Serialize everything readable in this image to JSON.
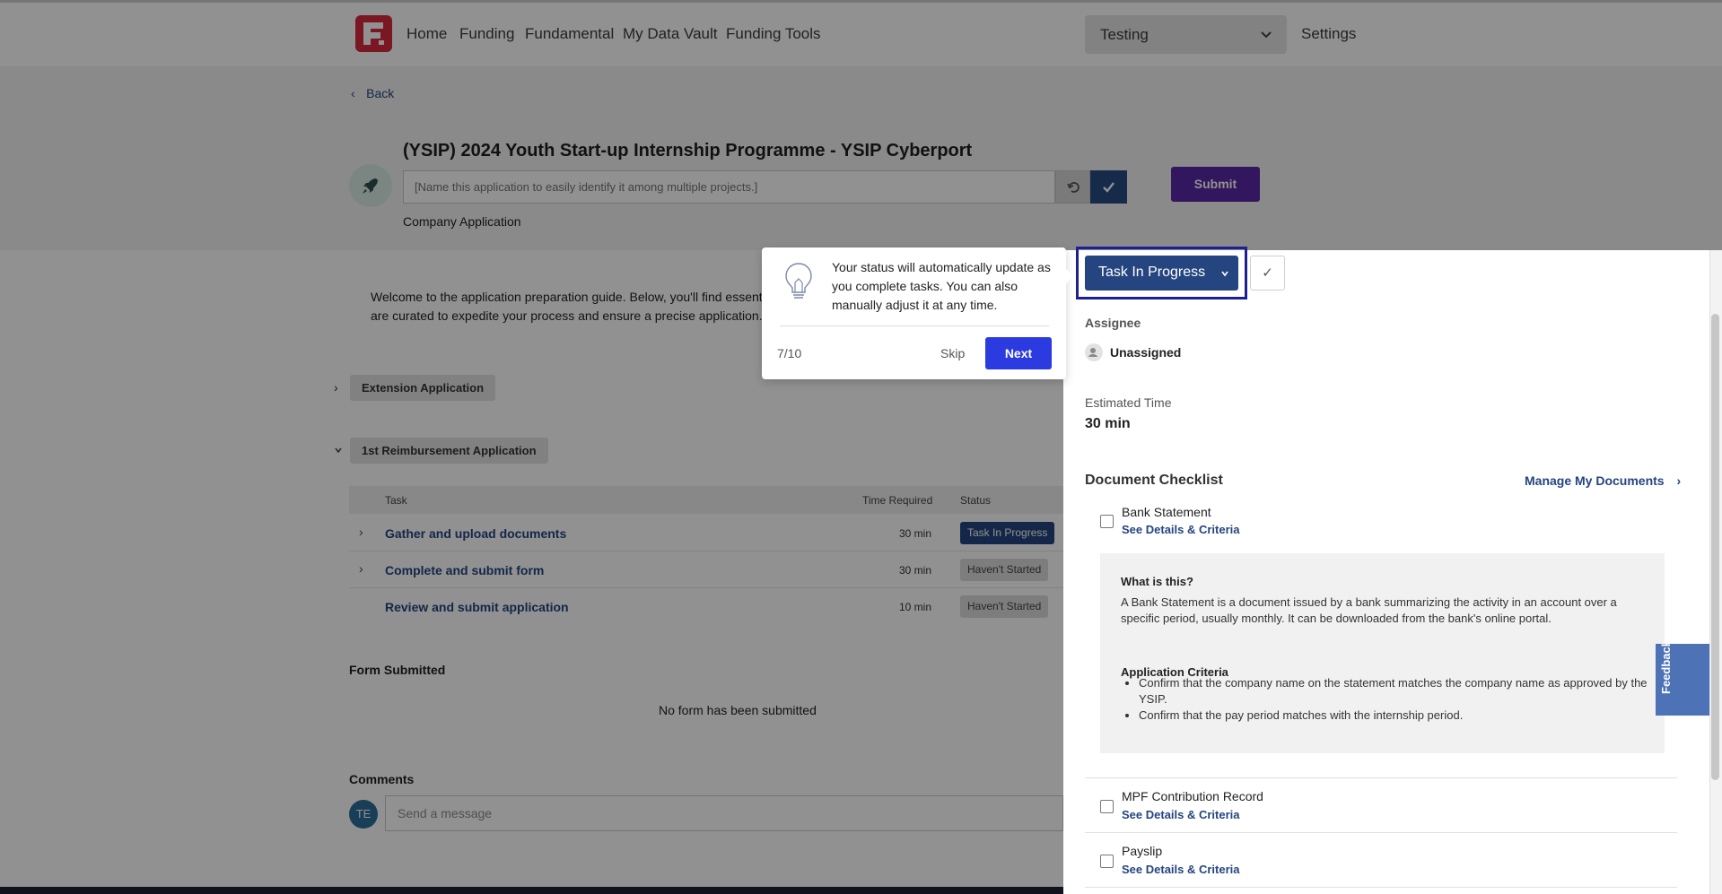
{
  "nav": {
    "logo_letter": "F.",
    "links": [
      "Home",
      "Funding",
      "Fundamental",
      "My Data Vault",
      "Funding Tools"
    ],
    "workspace": "Testing",
    "settings": "Settings"
  },
  "page": {
    "back": "Back",
    "title": "(YSIP) 2024 Youth Start-up Internship Programme - YSIP Cyberport",
    "name_placeholder": "[Name this application to easily identify it among multiple projects.]",
    "submit": "Submit",
    "company_app": "Company Application",
    "welcome": "Welcome to the application preparation guide. Below, you'll find essent... are curated to expedite your process and ensure a precise application.",
    "welcome_line1": "Welcome to the application preparation guide. Below, you'll find essent",
    "welcome_line2": "are curated to expedite your process and ensure a precise application."
  },
  "sections": [
    {
      "label": "Extension Application",
      "expanded": false
    },
    {
      "label": "1st Reimbursement Application",
      "expanded": true
    }
  ],
  "table": {
    "headers": {
      "task": "Task",
      "time": "Time Required",
      "status": "Status"
    },
    "rows": [
      {
        "task": "Gather and upload documents",
        "time": "30 min",
        "status": "Task In Progress"
      },
      {
        "task": "Complete and submit form",
        "time": "30 min",
        "status": "Haven't Started"
      },
      {
        "task": "Review and submit application",
        "time": "10 min",
        "status": "Haven't Started"
      }
    ]
  },
  "form_submitted": {
    "label": "Form Submitted",
    "empty": "No form has been submitted"
  },
  "comments": {
    "label": "Comments",
    "avatar": "TE",
    "placeholder": "Send a message"
  },
  "drawer": {
    "status": "Task In Progress",
    "assignee_label": "Assignee",
    "assignee": "Unassigned",
    "est_label": "Estimated Time",
    "est_value": "30 min",
    "checklist_label": "Document Checklist",
    "manage_link": "Manage My Documents",
    "docs": [
      {
        "name": "Bank Statement",
        "link": "See Details & Criteria"
      },
      {
        "name": "MPF Contribution Record",
        "link": "See Details & Criteria"
      },
      {
        "name": "Payslip",
        "link": "See Details & Criteria"
      }
    ],
    "detail": {
      "what_title": "What is this?",
      "what_text": "A Bank Statement is a document issued by a bank summarizing the activity in an account over a specific period, usually monthly. It can be downloaded from the bank's online portal.",
      "criteria_title": "Application Criteria",
      "criteria": [
        "Confirm that the company name on the statement matches the company name as approved by the YSIP.",
        "Confirm that the pay period matches with the internship period."
      ]
    },
    "feedback": "Feedback"
  },
  "tooltip": {
    "text": "Your status will automatically update as you complete tasks. You can also manually adjust it at any time.",
    "counter": "7/10",
    "skip": "Skip",
    "next": "Next"
  },
  "colors": {
    "brand": "#d8273e",
    "primary": "#24457f",
    "submit": "#5b2aa6",
    "next": "#2b3be0"
  }
}
